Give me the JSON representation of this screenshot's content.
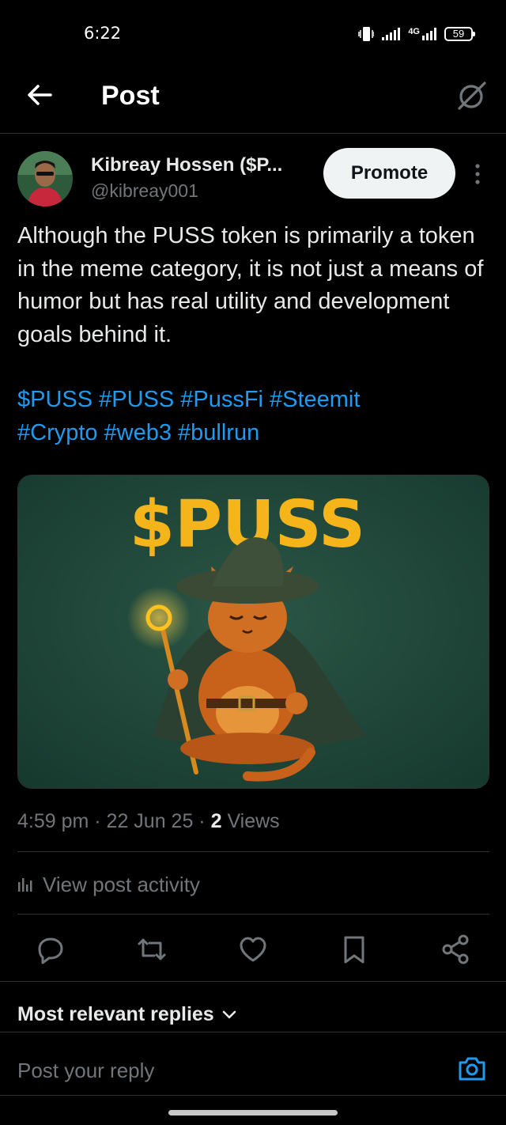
{
  "status_bar": {
    "time": "6:22",
    "network_label": "4G",
    "battery": "59"
  },
  "header": {
    "title": "Post"
  },
  "post": {
    "author_name": "Kibreay Hossen ($P...",
    "author_handle": "@kibreay001",
    "promote_label": "Promote",
    "text": "Although the PUSS token is primarily a token in the meme category, it is not just a means of humor but has real utility and development goals behind it.",
    "hashtags": [
      "$PUSS",
      "#PUSS",
      "#PussFi",
      "#Steemit",
      "#Crypto",
      "#web3",
      "#bullrun"
    ],
    "image_title": "$PUSS",
    "meta_time": "4:59 pm · 22 Jun 25 · ",
    "meta_views_count": "2",
    "meta_views_label": " Views",
    "activity_label": "View post activity"
  },
  "replies": {
    "sort_label": "Most relevant replies",
    "input_placeholder": "Post your reply"
  },
  "colors": {
    "background": "#000000",
    "text": "#e7e9ea",
    "muted": "#71767b",
    "link": "#1d9bf0",
    "divider": "#2f3336",
    "image_bg": "#1f4538",
    "image_text": "#f5b419"
  },
  "icons": {
    "back": "arrow-left-icon",
    "grok": "grok-icon",
    "more": "more-vertical-icon",
    "activity": "bar-chart-icon",
    "reply": "reply-icon",
    "repost": "repost-icon",
    "like": "heart-icon",
    "bookmark": "bookmark-icon",
    "share": "share-icon",
    "sort": "chevron-down-icon",
    "camera": "camera-icon"
  }
}
